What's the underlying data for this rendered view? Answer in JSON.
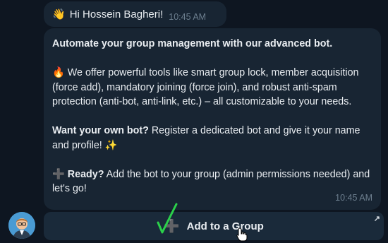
{
  "greeting": {
    "emoji": "👋",
    "text": "Hi Hossein Bagheri!",
    "time": "10:45 AM"
  },
  "message": {
    "headline": "Automate your group management with our advanced bot.",
    "features_emoji": "🔥",
    "features_text": "We offer powerful tools like smart group lock, member acquisition (force add), mandatory joining (force join), and robust anti-spam protection (anti-bot, anti-link, etc.) – all customizable to your needs.",
    "own_bot_bold": "Want your own bot?",
    "own_bot_text": "Register a dedicated bot and give it your name and profile!",
    "own_bot_emoji": "✨",
    "ready_emoji": "➕",
    "ready_bold": "Ready?",
    "ready_text": "Add the bot to your group (admin permissions needed) and let's go!",
    "time": "10:45 AM"
  },
  "inline_button": {
    "icon": "➕",
    "label": "Add to a Group",
    "link_icon": "↗"
  },
  "colors": {
    "background": "#0e1621",
    "bubble": "#182533",
    "button": "#1a2a3a",
    "check": "#2bd14a"
  }
}
